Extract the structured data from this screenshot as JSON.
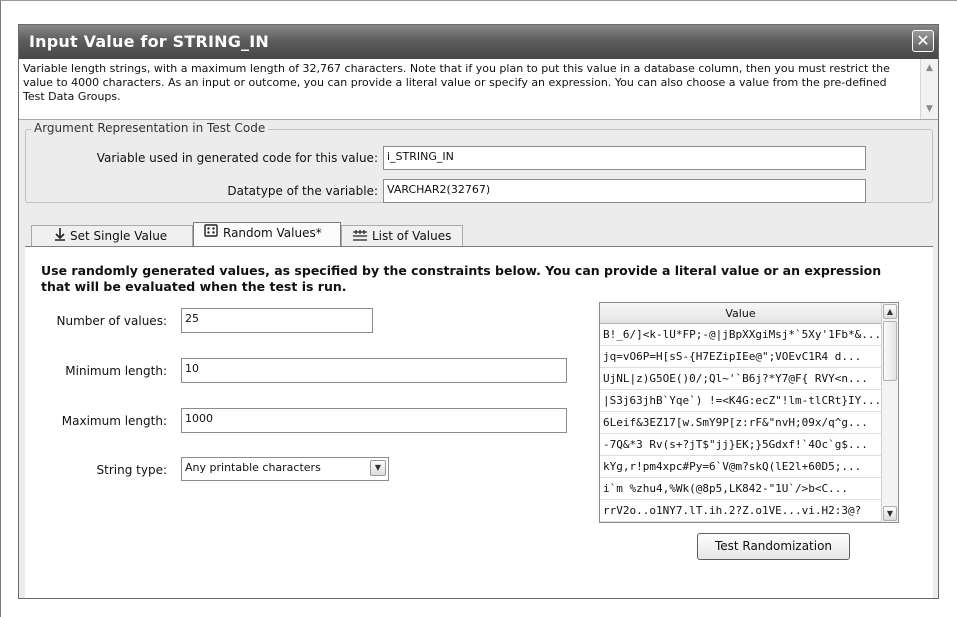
{
  "dialog": {
    "title": "Input Value for STRING_IN",
    "close_glyph": "✕",
    "description": "Variable length strings, with a maximum length of 32,767 characters. Note that if you plan to put this value in a database column, then you must restrict the value to 4000 characters. As an input or outcome, you can provide a literal value or specify an expression. You can also choose a value from the pre-defined Test Data Groups."
  },
  "argument": {
    "legend": "Argument Representation in Test Code",
    "variable_label": "Variable used in generated code for this value:",
    "variable_value": "i_STRING_IN",
    "datatype_label": "Datatype of the variable:",
    "datatype_value": "VARCHAR2(32767)"
  },
  "tabs": [
    {
      "label": "Set Single Value",
      "icon": "down-arrow-icon",
      "active": false
    },
    {
      "label": "Random Values*",
      "icon": "dice-icon",
      "active": true
    },
    {
      "label": "List of Values",
      "icon": "list-icon",
      "active": false
    }
  ],
  "random": {
    "instructions": "Use randomly generated values, as specified by the constraints below. You can provide a literal value or an expression that will be evaluated when the test is run.",
    "num_values_label": "Number of values:",
    "num_values": "25",
    "min_length_label": "Minimum length:",
    "min_length": "10",
    "max_length_label": "Maximum length:",
    "max_length": "1000",
    "string_type_label": "String type:",
    "string_type": "Any printable characters",
    "table_header": "Value",
    "values": [
      "B!_6/]<k-lU*FP;-@|jBpXXgiMsj*`5Xy'1Fb*&...",
      "jq=vO6P=H[sS-{H7EZipIEe@\";VOEvC1R4 d...",
      "UjNL|z)G5OE()0/;Ql~'`B6j?*Y7@F{ RVY<n...",
      "|S3j63jhB`Yqe`) !=<K4G:ecZ\"!lm-tlCRt}IY...",
      "6Leif&3EZ17[w.SmY9P[z:rF&\"nvH;09x/q^g...",
      "-7Q&*3 Rv(s+?jT$\"jj}EK;}5Gdxf!`4Oc`g$...",
      "kYg,r!pm4xpc#Py=6`V@m?skQ(lE2l+60D5;...",
      "i`m %zhu4,%Wk(@8p5,LK842-\"1U`/>b<C...",
      "rrV2o..o1NY7.lT.ih.2?Z.o1VE...vi.H2:3@?"
    ],
    "test_button": "Test Randomization"
  }
}
